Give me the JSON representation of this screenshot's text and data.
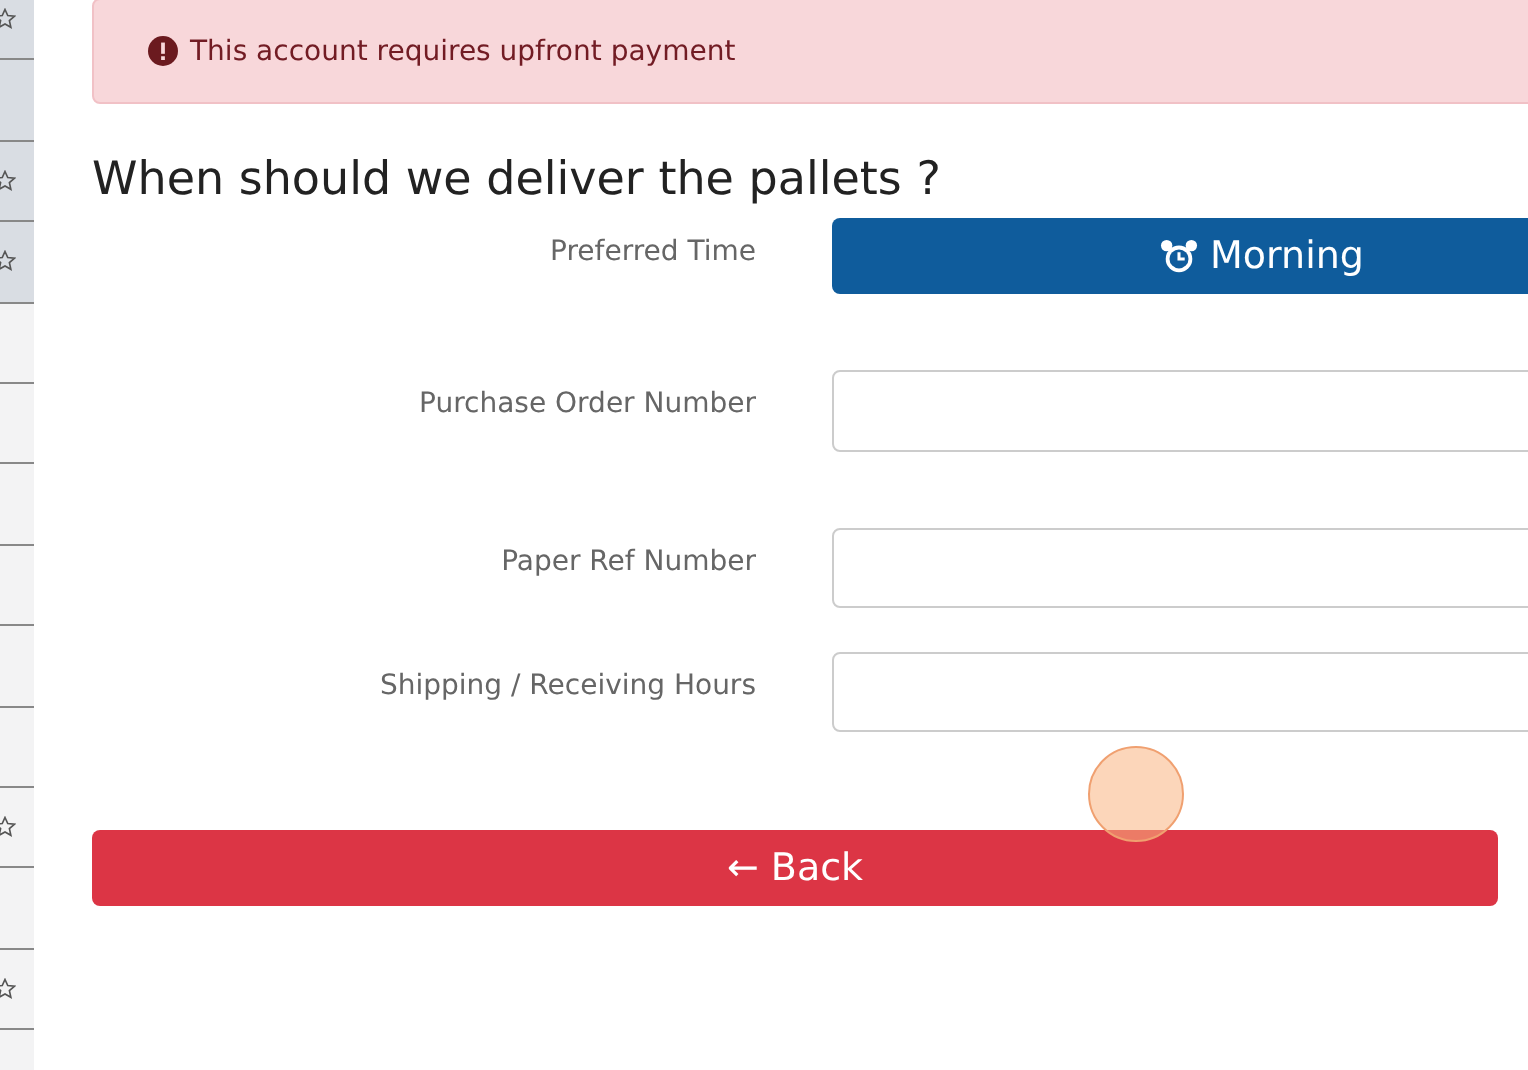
{
  "sidebar": {
    "rows": [
      {
        "starred": true,
        "selected": true
      },
      {
        "starred": false,
        "selected": true
      },
      {
        "starred": true,
        "selected": true
      },
      {
        "starred": true,
        "selected": true
      },
      {
        "starred": false,
        "selected": false
      },
      {
        "starred": false,
        "selected": false
      },
      {
        "starred": false,
        "selected": false
      },
      {
        "starred": false,
        "selected": false
      },
      {
        "starred": false,
        "selected": false
      },
      {
        "starred": false,
        "selected": false
      },
      {
        "starred": true,
        "selected": false
      },
      {
        "starred": false,
        "selected": false
      },
      {
        "starred": true,
        "selected": false
      },
      {
        "starred": false,
        "selected": false
      }
    ]
  },
  "alert": {
    "kind": "danger",
    "text": "This account requires upfront payment"
  },
  "heading": "When should we deliver the pallets ?",
  "form": [
    {
      "kind": "choice",
      "label": "Preferred Time",
      "value": "Morning"
    },
    {
      "kind": "input",
      "label": "Purchase Order Number"
    },
    {
      "kind": "input",
      "label": "Paper Ref Number"
    },
    {
      "kind": "input",
      "label": "Shipping / Receiving Hours"
    }
  ],
  "back_button": "← Back"
}
